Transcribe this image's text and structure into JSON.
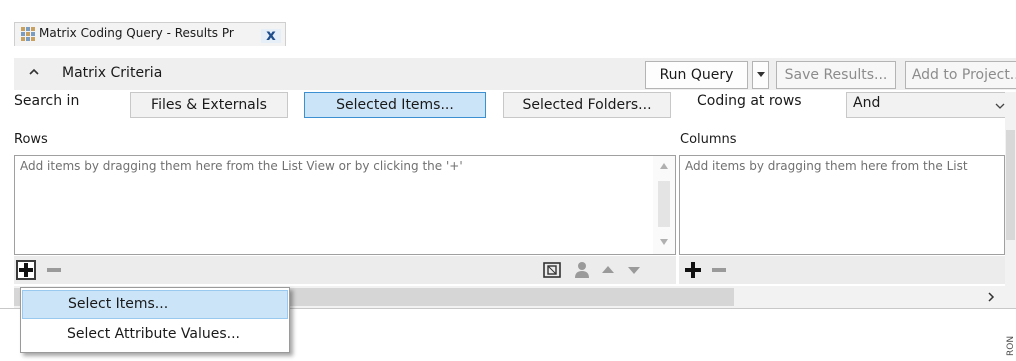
{
  "tab": {
    "title": "Matrix Coding Query - Results Pr",
    "close_label": "x"
  },
  "toolbar": {
    "section_label": "Matrix Criteria",
    "run_query": "Run Query",
    "save_results": "Save Results...",
    "add_to_project": "Add to Project..."
  },
  "search": {
    "label": "Search in",
    "options": [
      "Files & Externals",
      "Selected Items...",
      "Selected Folders..."
    ],
    "selected_option": "Selected Items...",
    "coding_label": "Coding at rows",
    "coding_value": "And"
  },
  "rows": {
    "label": "Rows",
    "hint": "Add items by dragging them here from the List View or by clicking the '+'"
  },
  "columns": {
    "label": "Columns",
    "hint": "Add items by dragging them here from the List"
  },
  "popup_menu": {
    "items": [
      "Select Items...",
      "Select Attribute Values..."
    ],
    "highlighted": "Select Items..."
  },
  "side_tag": "RON",
  "colors": {
    "accent": "#cce4f7",
    "accent_border": "#3c8fd0",
    "toolbar_bg": "#efefef"
  }
}
